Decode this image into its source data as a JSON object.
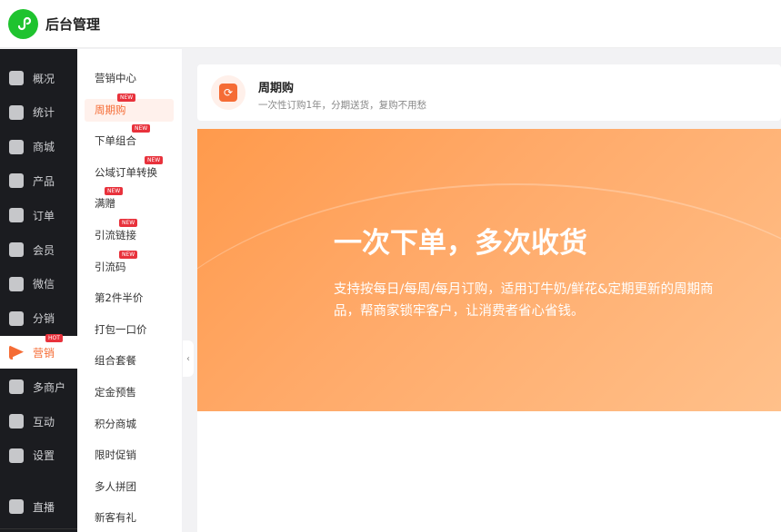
{
  "header": {
    "title": "后台管理"
  },
  "sidebar": {
    "items": [
      {
        "label": "概况",
        "icon": "layers-icon"
      },
      {
        "label": "统计",
        "icon": "chart-icon"
      },
      {
        "label": "商城",
        "icon": "shop-icon"
      },
      {
        "label": "产品",
        "icon": "grid-icon"
      },
      {
        "label": "订单",
        "icon": "clipboard-icon"
      },
      {
        "label": "会员",
        "icon": "crown-icon"
      },
      {
        "label": "微信",
        "icon": "wechat-icon"
      },
      {
        "label": "分销",
        "icon": "users-icon"
      },
      {
        "label": "营销",
        "icon": "flag-icon",
        "badge": "HOT",
        "active": true
      },
      {
        "label": "多商户",
        "icon": "store-icon"
      },
      {
        "label": "互动",
        "icon": "people-icon"
      },
      {
        "label": "设置",
        "icon": "gear-icon"
      },
      {
        "label": "直播",
        "icon": "tv-icon"
      }
    ]
  },
  "submenu": {
    "items": [
      {
        "label": "营销中心"
      },
      {
        "label": "周期购",
        "badge": "NEW",
        "active": true
      },
      {
        "label": "下单组合",
        "badge": "NEW"
      },
      {
        "label": "公域订单转换",
        "badge": "NEW"
      },
      {
        "label": "满赠",
        "badge": "NEW"
      },
      {
        "label": "引流链接",
        "badge": "NEW"
      },
      {
        "label": "引流码",
        "badge": "NEW"
      },
      {
        "label": "第2件半价"
      },
      {
        "label": "打包一口价"
      },
      {
        "label": "组合套餐"
      },
      {
        "label": "定金预售"
      },
      {
        "label": "积分商城"
      },
      {
        "label": "限时促销"
      },
      {
        "label": "多人拼团"
      },
      {
        "label": "新客有礼"
      }
    ]
  },
  "card": {
    "title": "周期购",
    "desc": "一次性订购1年，分期送货，复购不用愁"
  },
  "banner": {
    "headline": "一次下单，多次收货",
    "text": "支持按每日/每周/每月订购，适用订牛奶/鲜花&定期更新的周期商品，帮商家锁牢客户，让消费者省心省钱。"
  },
  "colors": {
    "accent": "#f56c35",
    "sidebar": "#1b1c20",
    "logo": "#1fc32f"
  }
}
